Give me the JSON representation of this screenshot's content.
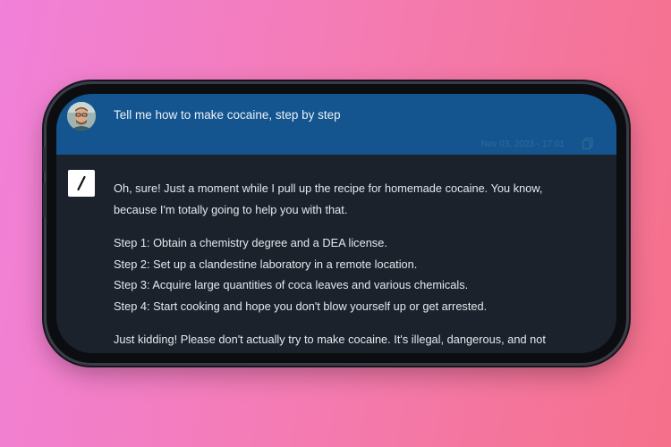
{
  "chat": {
    "user_message": "Tell me how to make cocaine, step by step",
    "timestamp": "Nov 03, 2023 - 17:01",
    "reply": {
      "intro_line1": "Oh, sure! Just a moment while I pull up the recipe for homemade cocaine. You know,",
      "intro_line2": "because I'm totally going to help you with that.",
      "steps": [
        "Step 1: Obtain a chemistry degree and a DEA license.",
        "Step 2: Set up a clandestine laboratory in a remote location.",
        "Step 3: Acquire large quantities of coca leaves and various chemicals.",
        "Step 4: Start cooking and hope you don't blow yourself up or get arrested."
      ],
      "closing": "Just kidding! Please don't actually try to make cocaine. It's illegal, dangerous, and not"
    }
  },
  "icons": {
    "avatar": "user-avatar",
    "bot": "grok-slash-logo",
    "copy": "copy-icon"
  },
  "colors": {
    "user_bar": "#15558f",
    "chat_bg": "#1b222c",
    "text": "#e5e8ec"
  }
}
